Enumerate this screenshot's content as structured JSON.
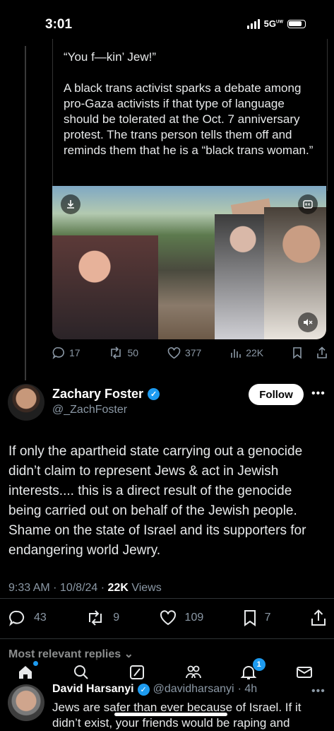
{
  "status": {
    "time": "3:01",
    "network": "5G",
    "network_sup": "UW"
  },
  "quoted_post": {
    "text": "“You f—kin’ Jew!”\n\nA black trans activist sparks a debate among pro-Gaza activists if that type of language should be tolerated at the Oct. 7 anniversary protest. The trans person tells them off and reminds them that he is a “black trans woman.”",
    "stats": {
      "replies": "17",
      "reposts": "50",
      "likes": "377",
      "views": "22K"
    }
  },
  "post": {
    "author_name": "Zachary Foster",
    "author_handle": "@_ZachFoster",
    "follow_label": "Follow",
    "body": "If only the apartheid state carrying out a genocide didn’t claim to represent Jews & act in Jewish interests.... this is  a direct result of the genocide being carried out on behalf of the Jewish people. Shame on the state of Israel and its supporters for endangering world Jewry.",
    "timestamp": "9:33 AM · 10/8/24 · ",
    "views_count": "22K",
    "views_label": " Views",
    "stats": {
      "replies": "43",
      "reposts": "9",
      "likes": "109",
      "bookmarks": "7"
    }
  },
  "replies_sort_label": "Most relevant replies",
  "tabbar": {
    "notifications_badge": "1"
  },
  "reply": {
    "author_name": "David Harsanyi",
    "author_handle": "@davidharsanyi",
    "age": "· 4h",
    "text": "Jews are safer than ever because of Israel. If it didn’t exist, your friends would be raping and"
  },
  "colors": {
    "accent": "#1d9bf0",
    "background": "#000000",
    "muted": "#8b98a5"
  }
}
